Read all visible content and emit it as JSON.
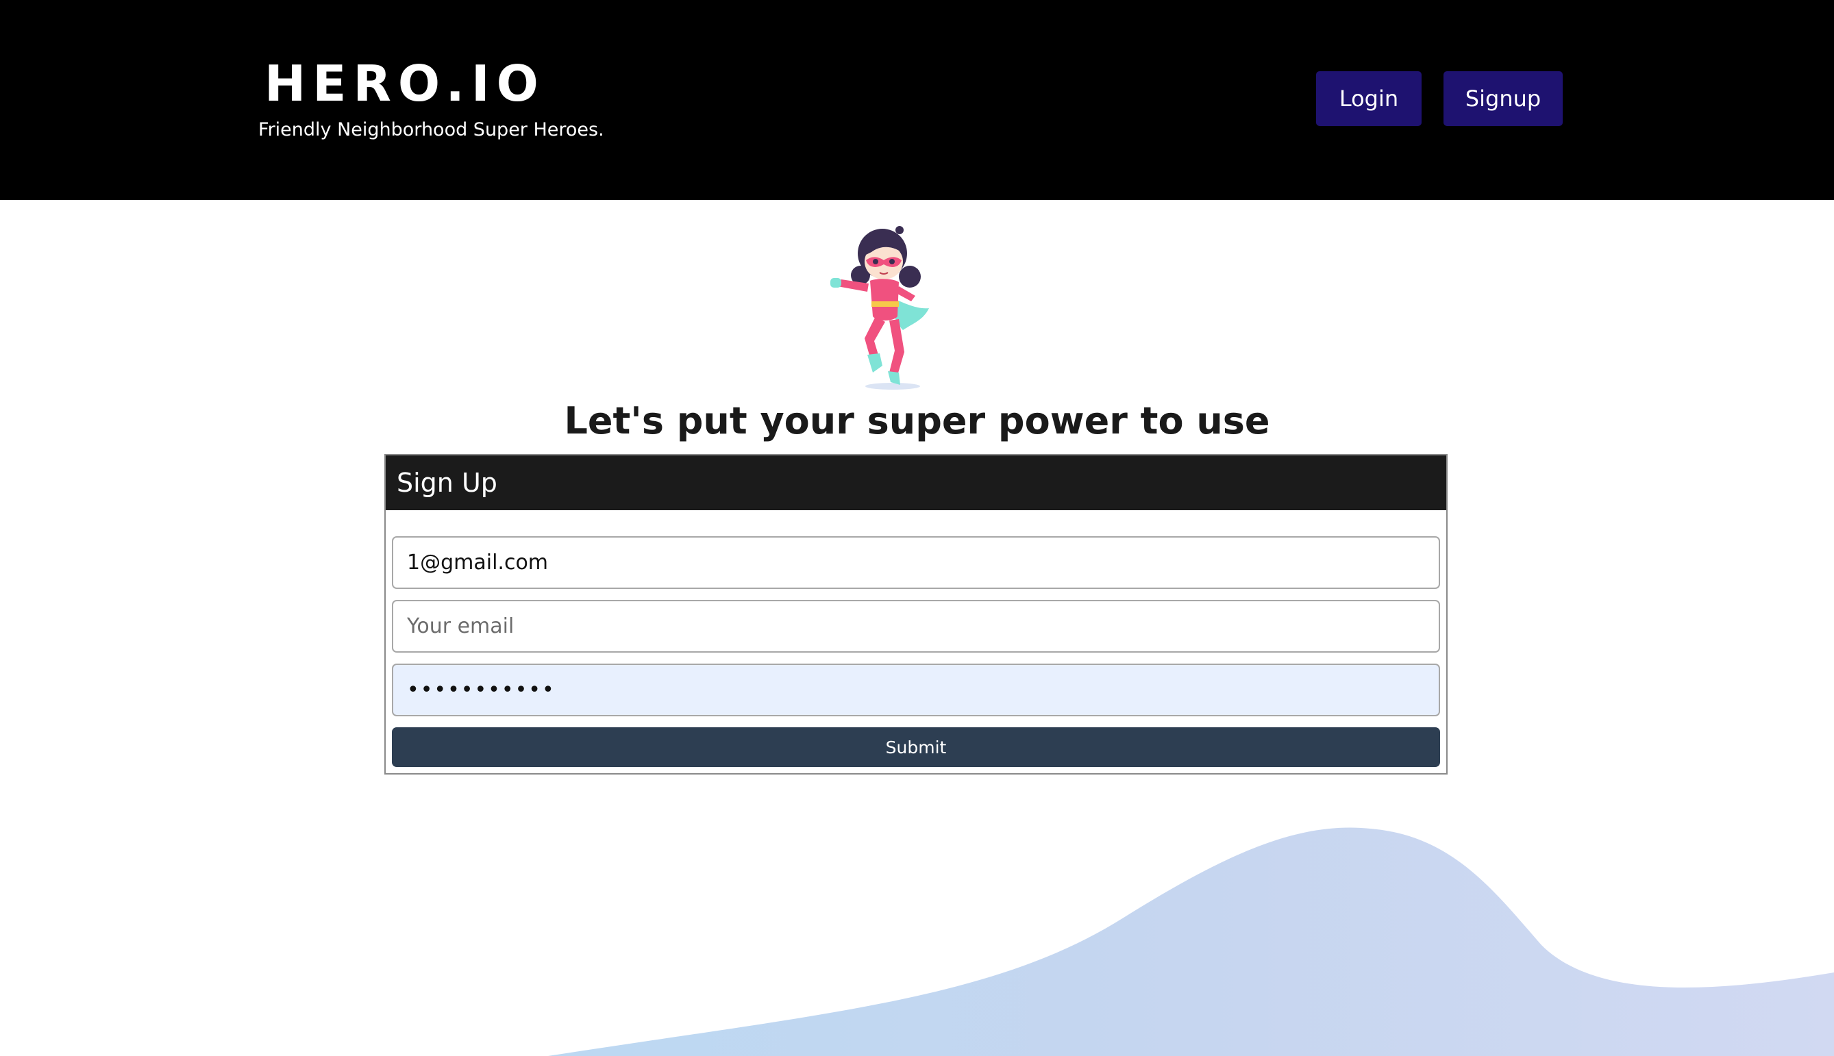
{
  "header": {
    "logo": "HERO.IO",
    "tagline": "Friendly Neighborhood Super Heroes.",
    "login_label": "Login",
    "signup_label": "Signup"
  },
  "main": {
    "heading": "Let's put your super power to use"
  },
  "form": {
    "title": "Sign Up",
    "name_value": "1@gmail.com",
    "email_placeholder": "Your email",
    "password_value": "passwordabc",
    "submit_label": "Submit"
  },
  "colors": {
    "header_bg": "#000000",
    "nav_button": "#1e1270",
    "card_header": "#1b1b1b",
    "submit_button": "#2d3e52",
    "password_autofill": "#e8f0fe",
    "wave": "#c5d7f0"
  },
  "icons": {
    "hero": "superhero-girl-illustration"
  }
}
